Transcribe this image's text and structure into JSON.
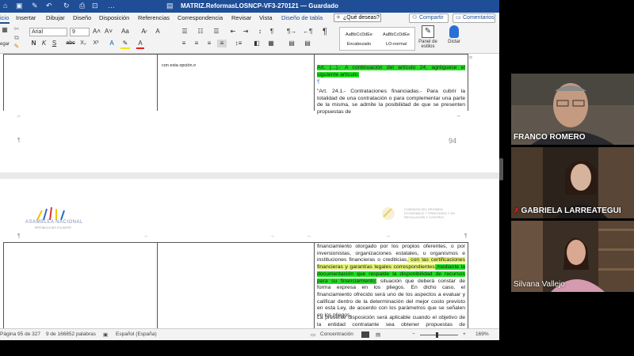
{
  "word": {
    "title": "MATRIZ.ReformasLOSNCP-VF3-270121 — Guardado",
    "tabs": [
      "icio",
      "Insertar",
      "Dibujar",
      "Diseño",
      "Disposición",
      "Referencias",
      "Correspondencia",
      "Revisar",
      "Vista",
      "Diseño de tabla"
    ],
    "search_placeholder": "¿Qué deseas?",
    "share_label": "Compartir",
    "comments_label": "Comentarios",
    "ribbon": {
      "font_name": "Arial",
      "font_size": "9",
      "paste_label": "egar",
      "style_1_preview": "AaBbCcDdEe",
      "style_1_name": "Encabezado",
      "style_2_preview": "AaBbCcDdEe",
      "style_2_name": "LO-normal",
      "styles_panel_label": "Panel de estilos",
      "dictate_label": "Dictar",
      "bold": "N",
      "italic": "K",
      "underline": "S",
      "strike": "abc",
      "subscript": "X₂",
      "superscript": "X²"
    },
    "document": {
      "page1_cell_note": "con esta opción.¤",
      "page1_text_a": "Art. (...).- A continuación del artículo 24, agréguese el siguiente artículo:",
      "page1_pilcrow": "¶",
      "page1_text_b": "\"Art. 24.1.- Contrataciones financiadas.- Para cubrir la totalidad de una contratación o para complementar una parte de la misma, se admite la posibilidad de que se presenten propuestas de",
      "page_number": "94",
      "logo_left_text": "ASAMBLEA NACIONAL",
      "logo_left_sub": "REPÚBLICA DEL ECUADOR",
      "logo_right_text": "COMISIÓN DEL RÉGIMEN ECONÓMICO Y TRIBUTARIO Y SU REGULACIÓN Y CONTROL",
      "page2_text_1": "financiamiento otorgado por los propios oferentes, o por inversionistas, organizaciones estatales, u organismos e instituciones financieras o crediticias,",
      "page2_hl_y1": " con las certificaciones financieras y garantías legales correspondientes",
      "page2_hl_g1": " mediante la documentación que respalde la disponibilidad de recursos para su financiamiento;",
      "page2_text_2": " situación que deberá constar de forma expresa en los pliegos. En dicho caso, el financiamiento ofrecido será uno de los aspectos a evaluar y calificar dentro de la determinación del mejor costo previsto en esta Ley, de acuerdo con los parámetros que se señalen en los pliegos.",
      "page2_text_3": "La presente disposición será aplicable cuando el objetivo de la entidad contratante sea obtener propuestas de financiamiento para"
    },
    "status": {
      "page": "Página 95 de 327",
      "words": "9 de 166852 palabras",
      "language": "Español (España)",
      "focus": "Concentración",
      "zoom": "169%"
    }
  },
  "participants": [
    {
      "name": "FRANCO ROMERO",
      "muted": false
    },
    {
      "name": "GABRIELA LARREATEGUI",
      "muted": true
    },
    {
      "name": "Silvana Vallejo",
      "muted": false
    }
  ],
  "colors": {
    "titlebar": "#1f4e96",
    "highlight_green": "#1de01d",
    "highlight_yellow": "#e5f36e",
    "mute_red": "#e02020"
  }
}
